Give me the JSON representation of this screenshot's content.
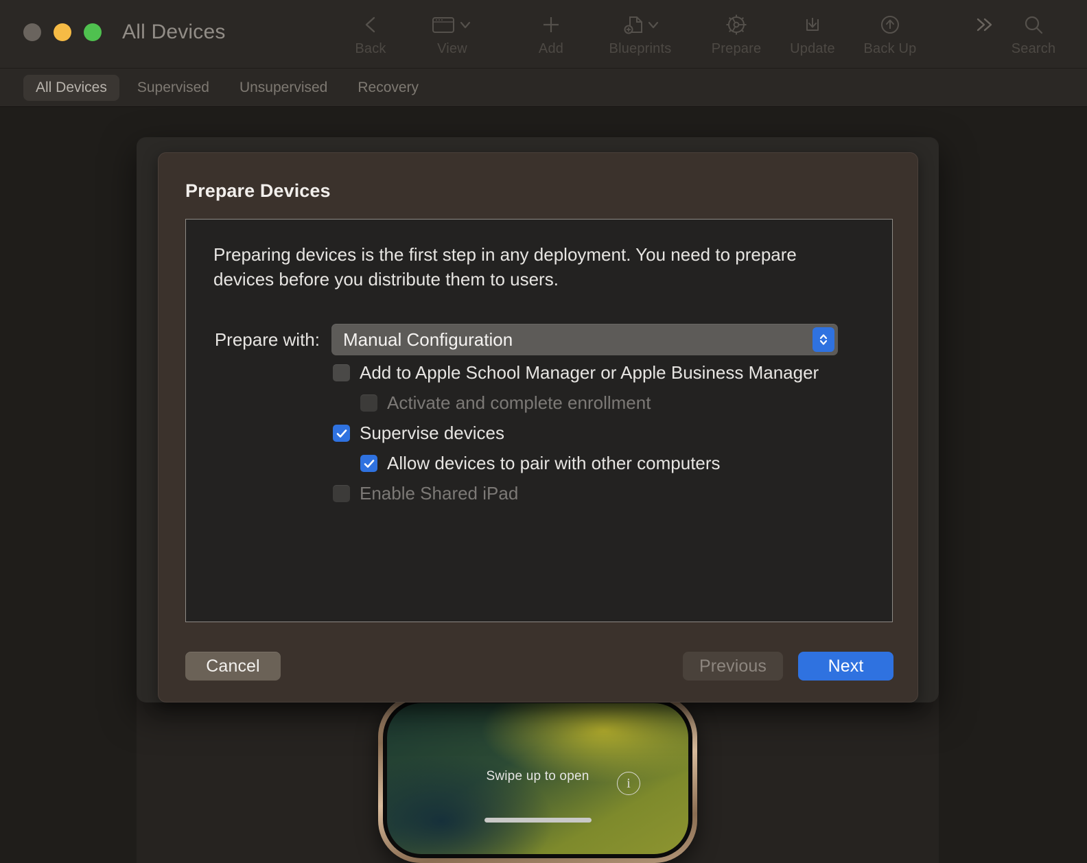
{
  "window": {
    "title": "All Devices",
    "traffic_lights": [
      "close",
      "minimize",
      "maximize"
    ]
  },
  "toolbar": {
    "items": [
      {
        "label": "Back",
        "icon": "chevron-left-icon"
      },
      {
        "label": "View",
        "icon": "window-icon"
      },
      {
        "label": "Add",
        "icon": "plus-icon"
      },
      {
        "label": "Blueprints",
        "icon": "document-add-icon"
      },
      {
        "label": "Prepare",
        "icon": "gear-icon"
      },
      {
        "label": "Update",
        "icon": "download-tray-icon"
      },
      {
        "label": "Back Up",
        "icon": "arrow-up-circle-icon"
      },
      {
        "label": "",
        "icon": "chevron-double-right-icon"
      },
      {
        "label": "Search",
        "icon": "search-icon"
      }
    ]
  },
  "tabs": [
    {
      "label": "All Devices",
      "active": true
    },
    {
      "label": "Supervised",
      "active": false
    },
    {
      "label": "Unsupervised",
      "active": false
    },
    {
      "label": "Recovery",
      "active": false
    }
  ],
  "sheet": {
    "title": "Prepare Devices",
    "blurb": "Preparing devices is the first step in any deployment. You need to prepare devices before you distribute them to users.",
    "prepare_with": {
      "label": "Prepare with:",
      "value": "Manual Configuration",
      "options": [
        "Manual Configuration"
      ]
    },
    "checkboxes": [
      {
        "label": "Add to Apple School Manager or Apple Business Manager",
        "checked": false,
        "enabled": true,
        "indent": 0
      },
      {
        "label": "Activate and complete enrollment",
        "checked": false,
        "enabled": false,
        "indent": 1
      },
      {
        "label": "Supervise devices",
        "checked": true,
        "enabled": true,
        "indent": 0
      },
      {
        "label": "Allow devices to pair with other computers",
        "checked": true,
        "enabled": true,
        "indent": 1
      },
      {
        "label": "Enable Shared iPad",
        "checked": false,
        "enabled": false,
        "indent": 0
      }
    ],
    "buttons": {
      "cancel": "Cancel",
      "previous": "Previous",
      "next": "Next"
    }
  },
  "background_device": {
    "lock_hint": "Swipe up to open",
    "info_glyph": "i"
  },
  "colors": {
    "accent_blue": "#2f72e0",
    "sheet_bg": "#3b322c",
    "panel_bg": "#232221",
    "titlebar_bg": "#2b2825",
    "window_bg": "#1f1d1a",
    "traffic_close": "#6a645e",
    "traffic_min": "#f6bb45",
    "traffic_max": "#4fc14f"
  }
}
